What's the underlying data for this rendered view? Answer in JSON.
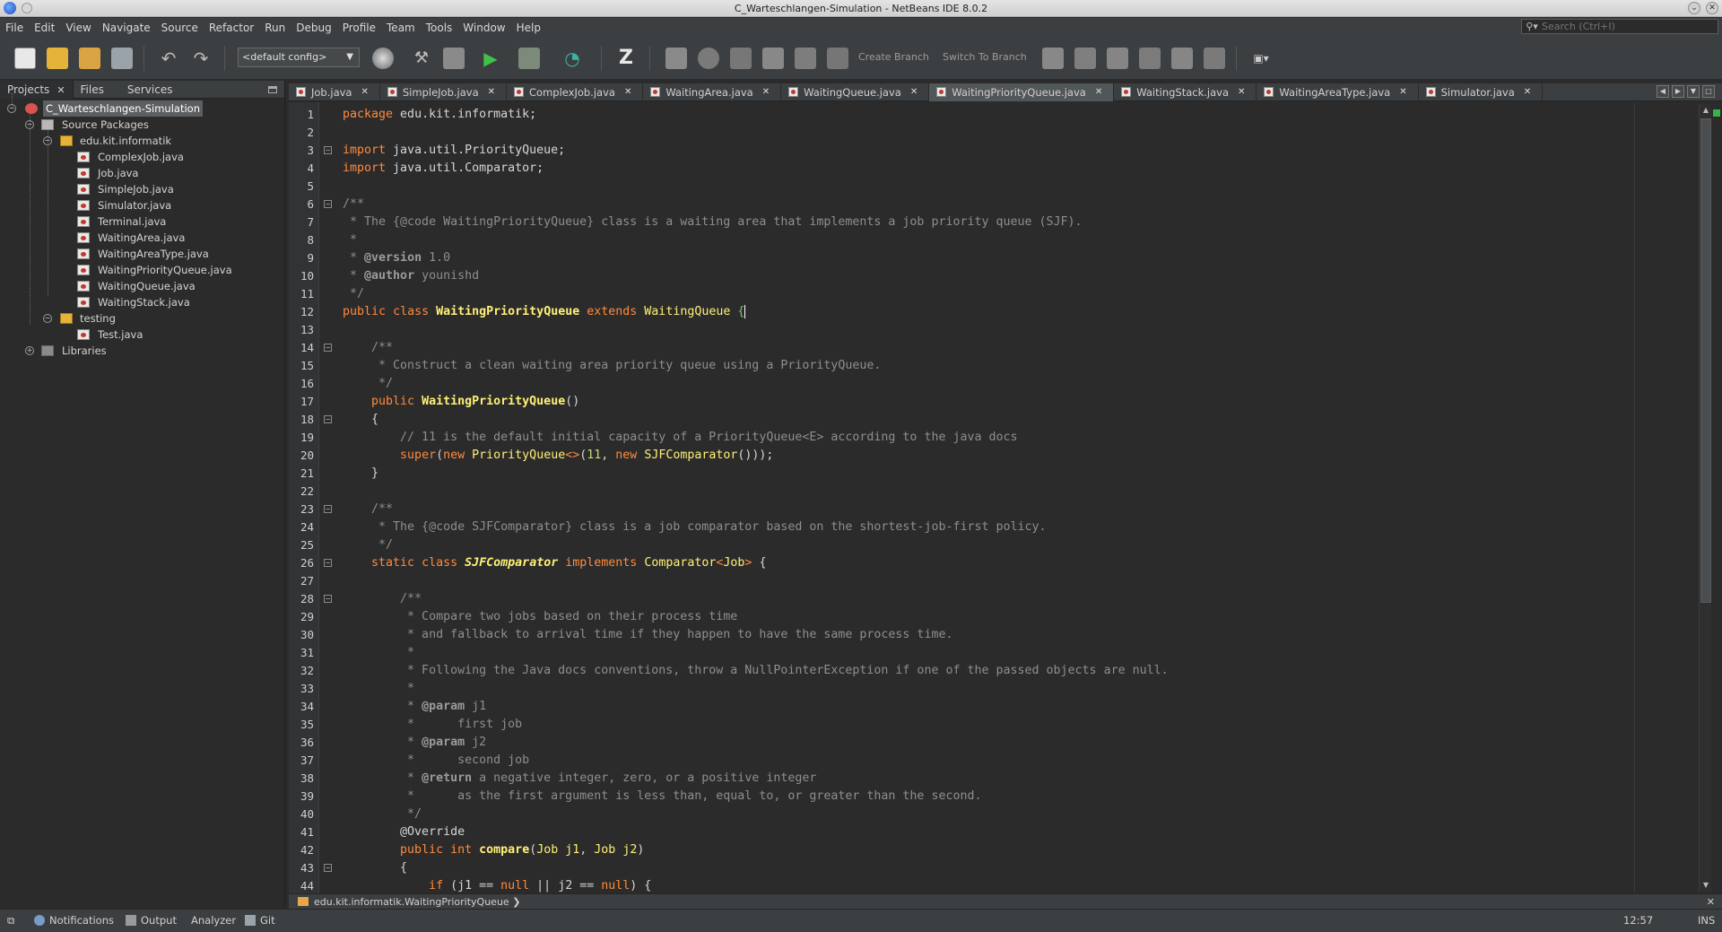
{
  "window": {
    "title": "C_Warteschlangen-Simulation - NetBeans IDE 8.0.2"
  },
  "menu": [
    "File",
    "Edit",
    "View",
    "Navigate",
    "Source",
    "Refactor",
    "Run",
    "Debug",
    "Profile",
    "Team",
    "Tools",
    "Window",
    "Help"
  ],
  "search": {
    "placeholder": "Search (Ctrl+I)"
  },
  "toolbar": {
    "config": "<default config>",
    "create_branch": "Create Branch",
    "switch_branch": "Switch To Branch"
  },
  "panel_tabs": {
    "projects": "Projects",
    "files": "Files",
    "services": "Services"
  },
  "tree": {
    "project": "C_Warteschlangen-Simulation",
    "source_packages": "Source Packages",
    "package": "edu.kit.informatik",
    "files": [
      "ComplexJob.java",
      "Job.java",
      "SimpleJob.java",
      "Simulator.java",
      "Terminal.java",
      "WaitingArea.java",
      "WaitingAreaType.java",
      "WaitingPriorityQueue.java",
      "WaitingQueue.java",
      "WaitingStack.java"
    ],
    "testing": "testing",
    "test_file": "Test.java",
    "libraries": "Libraries"
  },
  "editor_tabs": [
    "Job.java",
    "SimpleJob.java",
    "ComplexJob.java",
    "WaitingArea.java",
    "WaitingQueue.java",
    "WaitingPriorityQueue.java",
    "WaitingStack.java",
    "WaitingAreaType.java",
    "Simulator.java"
  ],
  "active_tab": "WaitingPriorityQueue.java",
  "code": {
    "l1_kw": "package",
    "l1_rest": " edu.kit.informatik;",
    "l3_kw": "import",
    "l3_rest": " java.util.PriorityQueue;",
    "l4_kw": "import",
    "l4_rest": " java.util.Comparator;",
    "l6": "/**",
    "l7": " * The {@code WaitingPriorityQueue} class is a waiting area that implements a job priority queue (SJF).",
    "l8": " *",
    "l9a": " * ",
    "l9b": "@version",
    "l9c": " 1.0",
    "l10a": " * ",
    "l10b": "@author",
    "l10c": " younishd",
    "l11": " */",
    "l12_public": "public",
    "l12_class": "class",
    "l12_name": "WaitingPriorityQueue",
    "l12_extends": "extends",
    "l12_parent": "WaitingQueue",
    "l14": "    /**",
    "l15": "     * Construct a clean waiting area priority queue using a PriorityQueue.",
    "l16": "     */",
    "l17_public": "public",
    "l17_name": "WaitingPriorityQueue",
    "l17_rest": "()",
    "l18": "    {",
    "l19": "        // 11 is the default initial capacity of a PriorityQueue<E> according to the java docs",
    "l20_super": "super",
    "l20_new": "new",
    "l20_pq": "PriorityQueue",
    "l20_diamond": "<>",
    "l20_num": "11",
    "l20_new2": "new",
    "l20_cmp": "SJFComparator",
    "l20_end": "()));",
    "l21": "    }",
    "l23": "    /**",
    "l24": "     * The {@code SJFComparator} class is a job comparator based on the shortest-job-first policy.",
    "l25": "     */",
    "l26_static": "static",
    "l26_class": "class",
    "l26_name": "SJFComparator",
    "l26_impl": "implements",
    "l26_iface": "Comparator",
    "l26_gen_open": "<",
    "l26_gen": "Job",
    "l26_gen_close": ">",
    "l28": "        /**",
    "l29": "         * Compare two jobs based on their process time",
    "l30": "         * and fallback to arrival time if they happen to have the same process time.",
    "l31": "         *",
    "l32": "         * Following the Java docs conventions, throw a NullPointerException if one of the passed objects are null.",
    "l33": "         *",
    "l34a": "         * ",
    "l34b": "@param",
    "l34c": " j1",
    "l35": "         *      first job",
    "l36a": "         * ",
    "l36b": "@param",
    "l36c": " j2",
    "l37": "         *      second job",
    "l38a": "         * ",
    "l38b": "@return",
    "l38c": " a negative integer, zero, or a positive integer",
    "l39": "         *      as the first argument is less than, equal to, or greater than the second.",
    "l40": "         */",
    "l41": "        @Override",
    "l42_public": "public",
    "l42_int": "int",
    "l42_name": "compare",
    "l42_t1": "Job",
    "l42_p1": "j1",
    "l42_t2": "Job",
    "l42_p2": "j2",
    "l43": "        {",
    "l44_if": "if",
    "l44_rest1": " (j1 == ",
    "l44_null": "null",
    "l44_or": " || j2 == ",
    "l44_null2": "null",
    "l44_end": ") {"
  },
  "breadcrumb": "edu.kit.informatik.WaitingPriorityQueue",
  "status": {
    "notifications": "Notifications",
    "output": "Output",
    "analyzer": "Analyzer",
    "git": "Git",
    "time": "12:57",
    "mode": "INS"
  }
}
